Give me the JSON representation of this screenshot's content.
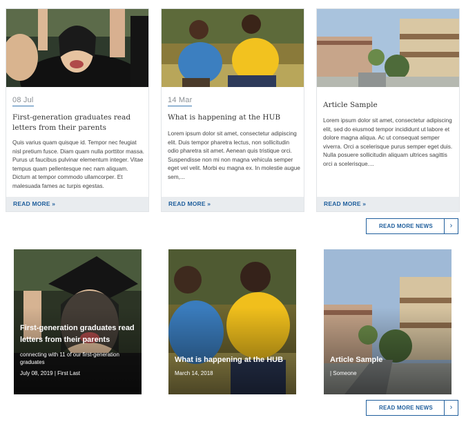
{
  "cards": [
    {
      "date": "08 Jul",
      "title": "First-generation graduates read letters from their parents",
      "excerpt": "Quis varius quam quisque id. Tempor nec feugiat nisl pretium fusce. Diam quam nulla porttitor massa. Purus ut faucibus pulvinar elementum integer. Vitae tempus quam pellentesque nec nam aliquam. Dictum at tempor commodo ullamcorper. Et malesuada fames ac turpis egestas.",
      "read_more": "READ MORE »"
    },
    {
      "date": "14 Mar",
      "title": "What is happening at the HUB",
      "excerpt": "Lorem ipsum dolor sit amet, consectetur adipiscing elit. Duis tempor pharetra lectus, non sollicitudin odio pharetra sit amet. Aenean quis tristique orci. Suspendisse non mi non magna vehicula semper eget vel velit. Morbi eu magna ex. In molestie augue sem,...",
      "read_more": "READ MORE »"
    },
    {
      "date": "",
      "title": "Article Sample",
      "excerpt": "Lorem ipsum dolor sit amet, consectetur adipiscing elit, sed do eiusmod tempor incididunt ut labore et dolore magna aliqua. Ac ut consequat semper viverra. Orci a scelerisque purus semper eget duis. Nulla posuere sollicitudin aliquam ultrices sagittis orci a scelerisque....",
      "read_more": "READ MORE »"
    }
  ],
  "read_more_news_top": {
    "label": "READ MORE NEWS",
    "arrow": "›"
  },
  "tiles": [
    {
      "title": "First-generation graduates read letters from their parents",
      "subtitle": "connecting with 11 of our first-generation graduates",
      "meta": "July 08, 2019 | First Last"
    },
    {
      "title": "What is happening at the HUB",
      "subtitle": "",
      "meta": "March 14, 2018"
    },
    {
      "title": "Article Sample",
      "subtitle": "",
      "meta": "| Someone"
    }
  ],
  "read_more_news_bottom": {
    "label": "READ MORE NEWS",
    "arrow": "›"
  },
  "colors": {
    "accent": "#1f5e9c",
    "readmore_bar": "#e9ecef",
    "border": "#e1e4e7"
  },
  "icons": {
    "button_arrow": "chevron-right-icon"
  }
}
